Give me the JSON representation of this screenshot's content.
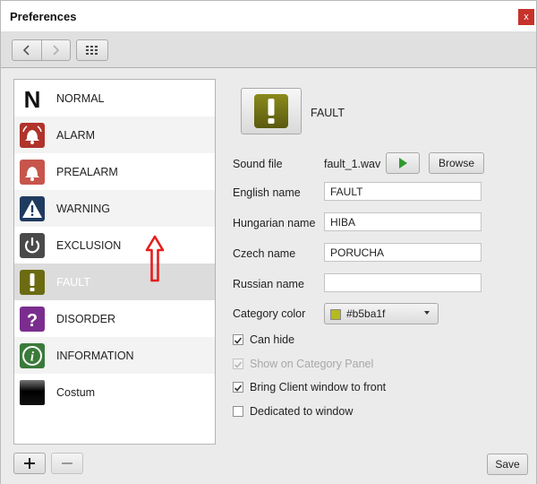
{
  "window": {
    "title": "Preferences",
    "close_label": "x"
  },
  "categories": [
    {
      "label": "NORMAL",
      "icon": "normal-n-icon"
    },
    {
      "label": "ALARM",
      "icon": "bell-red-icon"
    },
    {
      "label": "PREALARM",
      "icon": "bell-light-red-icon"
    },
    {
      "label": "WARNING",
      "icon": "warning-triangle-icon"
    },
    {
      "label": "EXCLUSION",
      "icon": "power-icon"
    },
    {
      "label": "FAULT",
      "icon": "exclamation-icon",
      "selected": true
    },
    {
      "label": "DISORDER",
      "icon": "question-icon"
    },
    {
      "label": "INFORMATION",
      "icon": "info-icon"
    },
    {
      "label": "Costum",
      "icon": "gradient-black-icon"
    }
  ],
  "detail": {
    "name": "FAULT",
    "sound_file_label": "Sound file",
    "sound_file_value": "fault_1.wav",
    "browse_label": "Browse",
    "english_label": "English name",
    "english_value": "FAULT",
    "hungarian_label": "Hungarian name",
    "hungarian_value": "HIBA",
    "czech_label": "Czech name",
    "czech_value": "PORUCHA",
    "russian_label": "Russian name",
    "russian_value": "",
    "color_label": "Category color",
    "color_value": "#b5ba1f",
    "checkboxes": [
      {
        "label": "Can hide",
        "checked": true,
        "disabled": false
      },
      {
        "label": "Show on Category Panel",
        "checked": true,
        "disabled": true
      },
      {
        "label": "Bring Client window to front",
        "checked": true,
        "disabled": false
      },
      {
        "label": "Dedicated to window",
        "checked": false,
        "disabled": false
      }
    ]
  },
  "footer": {
    "save_label": "Save"
  },
  "colors": {
    "selected_row": "#dcdcdc",
    "fault_olive": "#6b6b12",
    "alarm_red": "#b0332c",
    "accent_arrow": "#e31e1e"
  }
}
